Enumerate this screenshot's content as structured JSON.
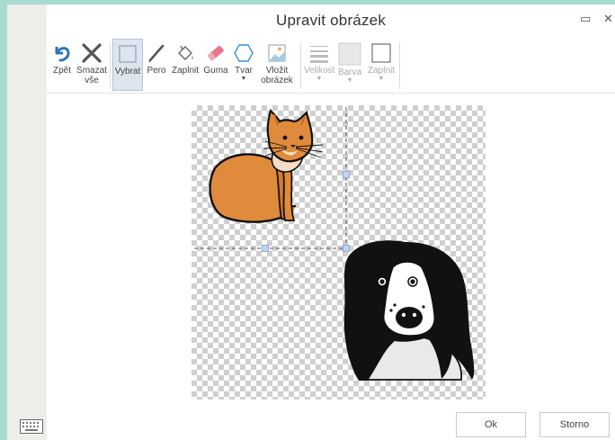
{
  "dialog": {
    "title": "Upravit obrázek",
    "maximize_glyph": "▭",
    "close_glyph": "✕"
  },
  "toolbar": {
    "undo": "Zpět",
    "clear_line1": "Smazat",
    "clear_line2": "vše",
    "select": "Vybrat",
    "pen": "Pero",
    "fill": "Zaplnit",
    "eraser": "Guma",
    "shape": "Tvar",
    "insert_line1": "Vložit",
    "insert_line2": "obrázek",
    "size": "Velikost",
    "color": "Barva",
    "fill_option": "Zaplnit"
  },
  "footer": {
    "ok": "Ok",
    "cancel": "Storno"
  },
  "colors": {
    "accent_blue": "#2a74b8",
    "cat_orange": "#e08a3c",
    "selection": "#8aa8d8"
  }
}
